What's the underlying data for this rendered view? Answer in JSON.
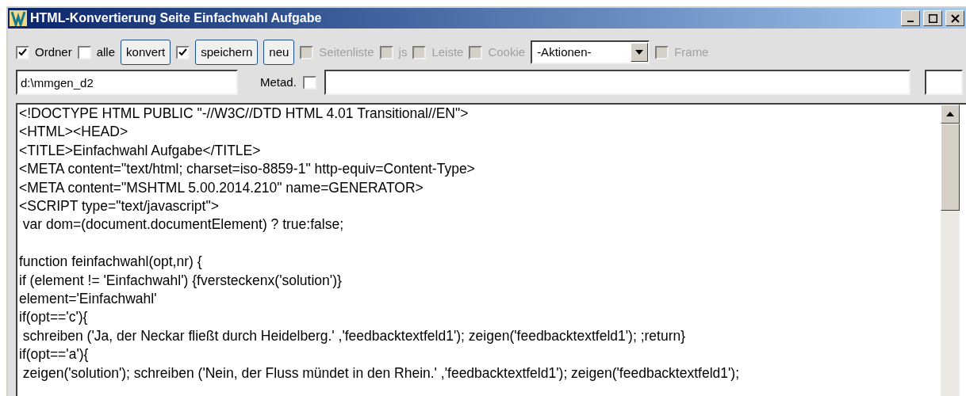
{
  "window": {
    "title": "HTML-Konvertierung Seite Einfachwahl Aufgabe"
  },
  "toolbar": [
    {
      "kind": "checkbox",
      "label": "Ordner",
      "checked": true,
      "disabled": false
    },
    {
      "kind": "checkbox",
      "label": "alle",
      "checked": false,
      "disabled": false
    },
    {
      "kind": "button",
      "label": "konvert"
    },
    {
      "kind": "checkbox",
      "checked": true,
      "disabled": false
    },
    {
      "kind": "button",
      "label": "speichern"
    },
    {
      "kind": "button",
      "label": "neu"
    },
    {
      "kind": "checkbox",
      "label": "Seitenliste",
      "checked": false,
      "disabled": true
    },
    {
      "kind": "checkbox",
      "label": "js",
      "checked": false,
      "disabled": true
    },
    {
      "kind": "checkbox",
      "label": "Leiste",
      "checked": false,
      "disabled": true
    },
    {
      "kind": "checkbox",
      "label": "Cookie",
      "checked": false,
      "disabled": true
    },
    {
      "kind": "dropdown",
      "value": "-Aktionen-"
    },
    {
      "kind": "checkbox",
      "label": "Frame",
      "checked": false,
      "disabled": true
    }
  ],
  "path_field": {
    "value": "d:\\mmgen_d2"
  },
  "metadata": {
    "label": "Metad.",
    "checked": false
  },
  "editor": {
    "text": "<!DOCTYPE HTML PUBLIC \"-//W3C//DTD HTML 4.01 Transitional//EN\">\n<HTML><HEAD>\n<TITLE>Einfachwahl Aufgabe</TITLE>\n<META content=\"text/html; charset=iso-8859-1\" http-equiv=Content-Type>\n<META content=\"MSHTML 5.00.2014.210\" name=GENERATOR>\n<SCRIPT type=\"text/javascript\">\n var dom=(document.documentElement) ? true:false;\n\nfunction feinfachwahl(opt,nr) {\nif (element != 'Einfachwahl') {fversteckenx('solution')}\nelement='Einfachwahl'\nif(opt=='c'){\n schreiben ('Ja, der Neckar fließt durch Heidelberg.' ,'feedbacktextfeld1'); zeigen('feedbacktextfeld1'); ;return}\nif(opt=='a'){\n zeigen('solution'); schreiben ('Nein, der Fluss mündet in den Rhein.' ,'feedbacktextfeld1'); zeigen('feedbacktextfeld1');"
  }
}
